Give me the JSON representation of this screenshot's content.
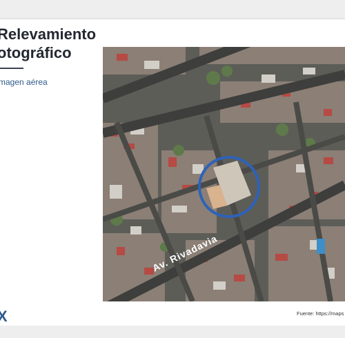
{
  "slide": {
    "title_line1": "Relevamiento",
    "title_line2": "otográfico",
    "subtitle": "magen aérea",
    "logo_text": "X",
    "source": "Fuente: https://maps"
  },
  "map": {
    "street_label": "Av. Rivadavia",
    "highlight_color": "#2e62b8",
    "icon": "aerial-photo"
  }
}
